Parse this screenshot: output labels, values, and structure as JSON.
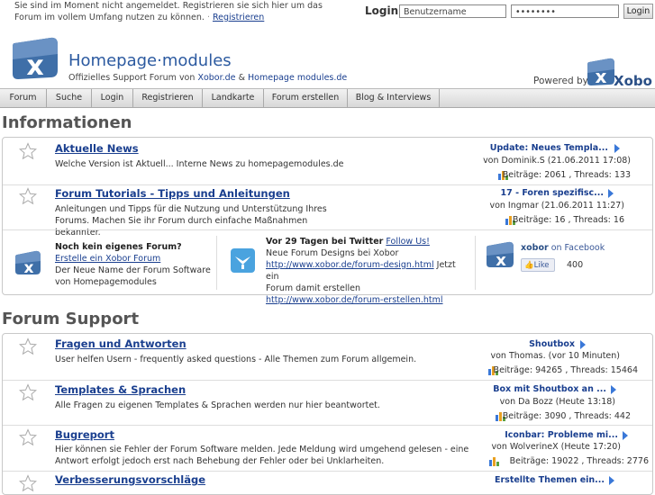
{
  "topbar": {
    "notice_line1": "Sie sind im Moment nicht angemeldet. Registrieren sie sich hier um das",
    "notice_line2": "Forum im vollem Umfang nutzen zu können.",
    "register_link": "Registrieren",
    "login_label": "Login",
    "username_placeholder": "Benutzername",
    "password_value": "••••••••",
    "login_button": "Login"
  },
  "header": {
    "title": "Homepage·modules",
    "subtitle_prefix": "Offizielles Support Forum von",
    "link1": "Xobor.de",
    "amp": "&",
    "link2": "Homepage modules.de",
    "powered_by": "Powered by",
    "xobor": "Xobor"
  },
  "nav": {
    "items": [
      "Forum",
      "Suche",
      "Login",
      "Registrieren",
      "Landkarte",
      "Forum erstellen",
      "Blog & Interviews"
    ]
  },
  "categories": [
    {
      "title": "Informationen",
      "forums": [
        {
          "title": "Aktuelle News",
          "description": "Welche Version ist Aktuell... Interne News zu homepagemodules.de",
          "last_title": "Update: Neues Templa...",
          "last_by": "von Dominik.S (21.06.2011 17:08)",
          "stats": "Beiträge: 2061 , Threads: 133"
        },
        {
          "title": "Forum Tutorials - Tipps und Anleitungen",
          "description": "Anleitungen und Tipps für die Nutzung und Unterstützung Ihres Forums. Machen Sie ihr Forum durch einfache Maßnahmen bekannter.",
          "last_title": "17 - Foren spezifisc...",
          "last_by": "von Ingmar (21.06.2011 11:27)",
          "stats": "Beiträge: 16 , Threads: 16"
        }
      ],
      "promo": {
        "own_title": "Noch kein eigenes Forum?",
        "own_link": "Erstelle ein Xobor Forum",
        "own_text1": "Der Neue Name der Forum Software",
        "own_text2": "von Homepagemodules",
        "twitter_prefix": "Vor 29 Tagen bei Twitter",
        "twitter_follow": "Follow Us!",
        "twitter_line2": "Neue Forum Designs bei Xobor",
        "twitter_link1": "http://www.xobor.de/forum-design.html",
        "twitter_mid": "Jetzt ein",
        "twitter_line4": "Forum damit erstellen",
        "twitter_link2": "http://www.xobor.de/forum-erstellen.html",
        "fb_brand": "xobor",
        "fb_on": "on Facebook",
        "fb_like": "Like",
        "fb_count": "400"
      }
    },
    {
      "title": "Forum Support",
      "forums": [
        {
          "title": "Fragen und Antworten",
          "description": "User helfen Usern - frequently asked questions - Alle Themen zum Forum allgemein.",
          "last_title": "Shoutbox",
          "last_by": "von Thomas. (vor 10 Minuten)",
          "stats": "Beiträge: 94265 , Threads: 15464"
        },
        {
          "title": "Templates & Sprachen",
          "description": "Alle Fragen zu eigenen Templates & Sprachen werden nur hier beantwortet.",
          "last_title": "Box mit Shoutbox an ...",
          "last_by": "von Da Bozz (Heute 13:18)",
          "stats": "Beiträge: 3090 , Threads: 442"
        },
        {
          "title": "Bugreport",
          "description": "Hier können sie Fehler der Forum Software melden. Jede Meldung wird umgehend gelesen - eine Antwort erfolgt jedoch erst nach Behebung der Fehler oder bei Unklarheiten.",
          "last_title": "Iconbar: Probleme mi...",
          "last_by": "von WolverineX (Heute 17:20)",
          "stats": "Beiträge: 19022 , Threads: 2776"
        },
        {
          "title": "Verbesserungsvorschläge",
          "description": "",
          "last_title": "Erstellte Themen ein...",
          "last_by": "",
          "stats": ""
        }
      ]
    }
  ],
  "colors": {
    "link": "#1a3f8f",
    "accent": "#2c5aa0",
    "arrow": "#3a78d8",
    "logo": "#3f6fa8"
  }
}
